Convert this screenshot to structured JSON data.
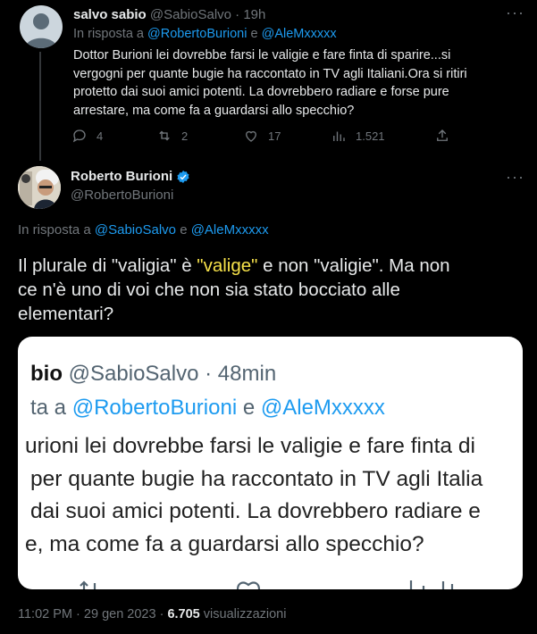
{
  "reply": {
    "name": "salvo sabio",
    "handle": "@SabioSalvo",
    "sep": "·",
    "time": "19h",
    "in_reply_prefix": "In risposta a",
    "mention1": "@RobertoBurioni",
    "and": "e",
    "mention2": "@AleMxxxxx",
    "lines": [
      "Dottor Burioni lei dovrebbe farsi le valigie e fare finta di sparire...si",
      "vergogni per quante bugie ha raccontato in TV agli Italiani.Ora si ritiri",
      "protetto dai suoi amici potenti. La dovrebbero radiare e forse pure",
      "arrestare, ma come fa a guardarsi allo specchio?"
    ],
    "replies": "4",
    "retweets": "2",
    "likes": "17",
    "views": "1.521",
    "more": "···"
  },
  "main": {
    "name": "Roberto Burioni",
    "handle": "@RobertoBurioni",
    "more": "···",
    "in_reply_prefix": "In risposta a",
    "mention1": "@SabioSalvo",
    "and": "e",
    "mention2": "@AleMxxxxx",
    "text_line1_a": "Il plurale di \"valigia\" è ",
    "text_highlight": "\"valige\"",
    "text_line1_b": " e non \"valigie\". Ma non",
    "text_line2": "ce n'è uno di voi che non sia stato bocciato alle",
    "text_line3": "elementari?",
    "highlight_color": "#f7e24a",
    "time": "11:02 PM",
    "sep": "·",
    "date": "29 gen 2023",
    "views_count": "6.705",
    "views_label": "visualizzazioni"
  },
  "screenshot": {
    "header_name": "bio",
    "handle": "@SabioSalvo",
    "sep": "·",
    "time": "48min",
    "reply_prefix": "ta a",
    "mention1": "@RobertoBurioni",
    "and": "e",
    "mention2": "@AleMxxxxx",
    "lines": [
      "urioni lei dovrebbe farsi le valigie e fare finta di",
      "per quante bugie ha raccontato in TV agli Italia",
      "dai suoi amici potenti. La dovrebbero radiare e",
      "e, ma come fa a guardarsi allo specchio?"
    ]
  }
}
